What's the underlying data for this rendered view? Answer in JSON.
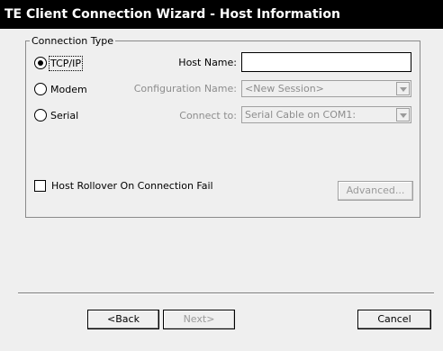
{
  "window": {
    "title": "TE Client Connection Wizard - Host Information"
  },
  "connection_type": {
    "legend": "Connection Type",
    "options": [
      {
        "label": "TCP/IP",
        "checked": true
      },
      {
        "label": "Modem",
        "checked": false
      },
      {
        "label": "Serial",
        "checked": false
      }
    ]
  },
  "fields": {
    "host_name": {
      "label": "Host Name:",
      "value": ""
    },
    "configuration_name": {
      "label": "Configuration Name:",
      "value": "<New Session>"
    },
    "connect_to": {
      "label": "Connect to:",
      "value": "Serial Cable on COM1:"
    }
  },
  "host_rollover": {
    "label": "Host Rollover On Connection Fail",
    "checked": false
  },
  "buttons": {
    "advanced": "Advanced...",
    "back": "<Back",
    "next": "Next>",
    "cancel": "Cancel"
  }
}
